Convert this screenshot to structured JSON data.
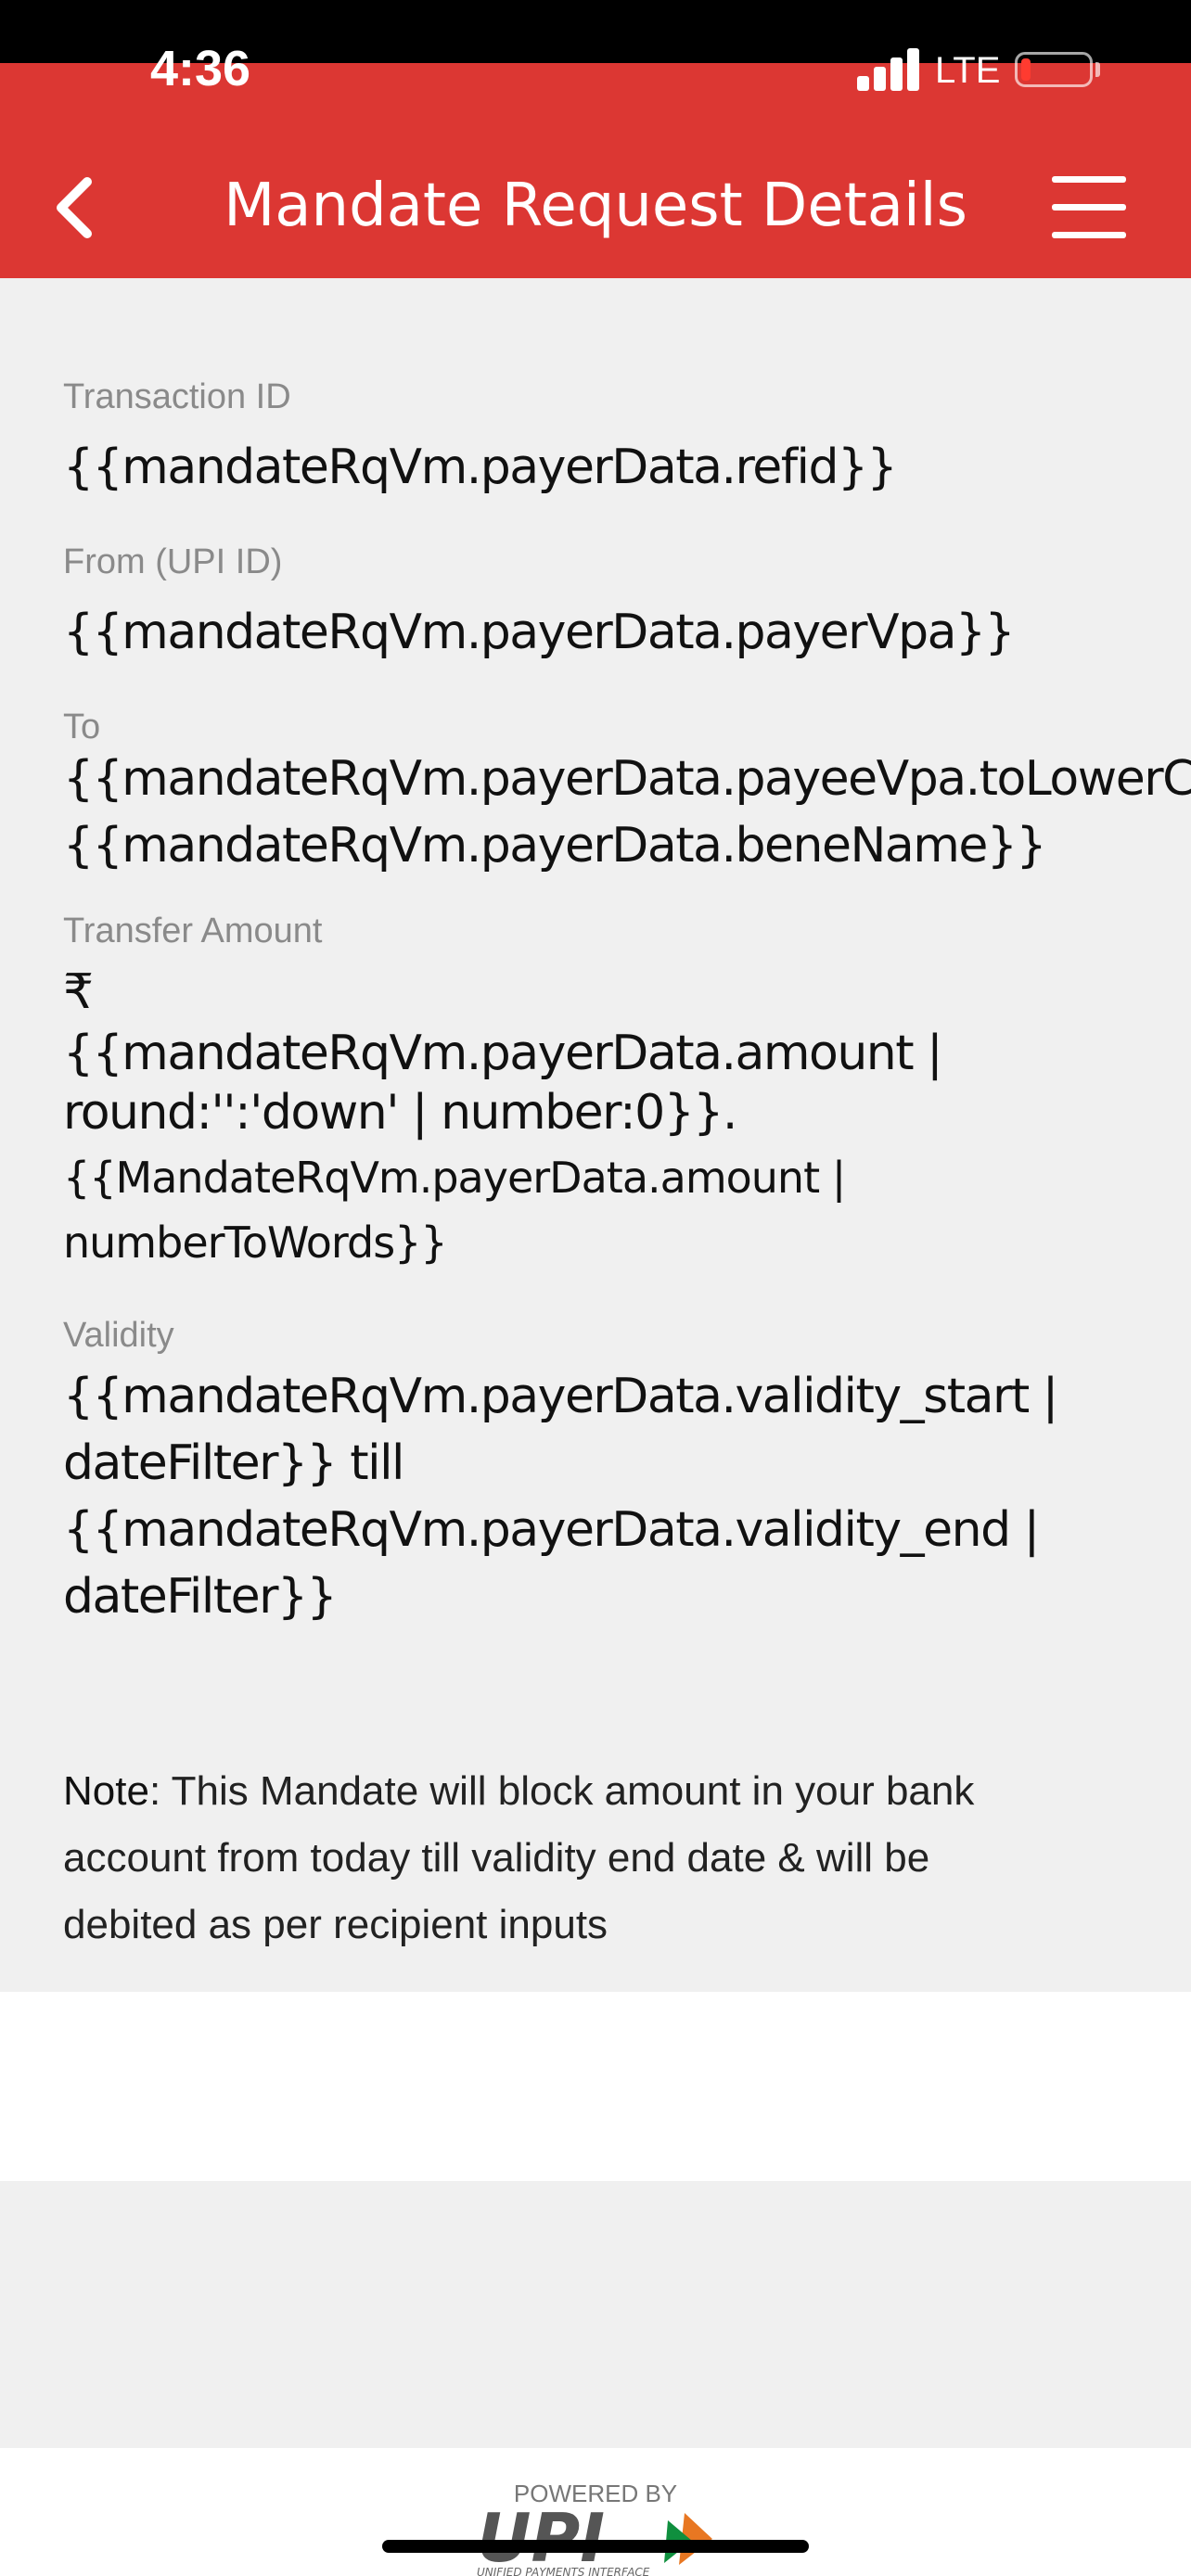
{
  "status_bar": {
    "time": "4:36",
    "network": "LTE"
  },
  "header": {
    "title": "Mandate Request Details"
  },
  "fields": {
    "transaction_id": {
      "label": "Transaction ID",
      "value": "{{mandateRqVm.payerData.refid}}"
    },
    "from": {
      "label": "From (UPI ID)",
      "value": "{{mandateRqVm.payerData.payerVpa}}"
    },
    "to": {
      "label": "To",
      "value_line1": "{{mandateRqVm.payerData.payeeVpa.toLowerCas",
      "value_line2": "{{mandateRqVm.payerData.beneName}}"
    },
    "transfer_amount": {
      "label": "Transfer Amount",
      "currency": "₹",
      "amount_line1": "{{mandateRqVm.payerData.amount |",
      "amount_line2": "round:'':'down' | number:0}}.",
      "words_line1": "{{MandateRqVm.payerData.amount |",
      "words_line2": "numberToWords}}"
    },
    "validity": {
      "label": "Validity",
      "line1": "{{mandateRqVm.payerData.validity_start |",
      "line2": "dateFilter}} till",
      "line3": "{{mandateRqVm.payerData.validity_end |",
      "line4": "dateFilter}}"
    }
  },
  "note": {
    "prefix": "Note",
    "line1": ": This Mandate will block amount in your bank",
    "line2": "account from today till validity end date & will be",
    "line3": "debited as per recipient inputs"
  },
  "footer": {
    "powered_by": "POWERED BY",
    "logo": "UPI",
    "logo_tagline": "UNIFIED PAYMENTS INTERFACE"
  },
  "colors": {
    "header_red": "#dc3733",
    "background": "#f0f0f0",
    "label_grey": "#8a8a8a"
  }
}
